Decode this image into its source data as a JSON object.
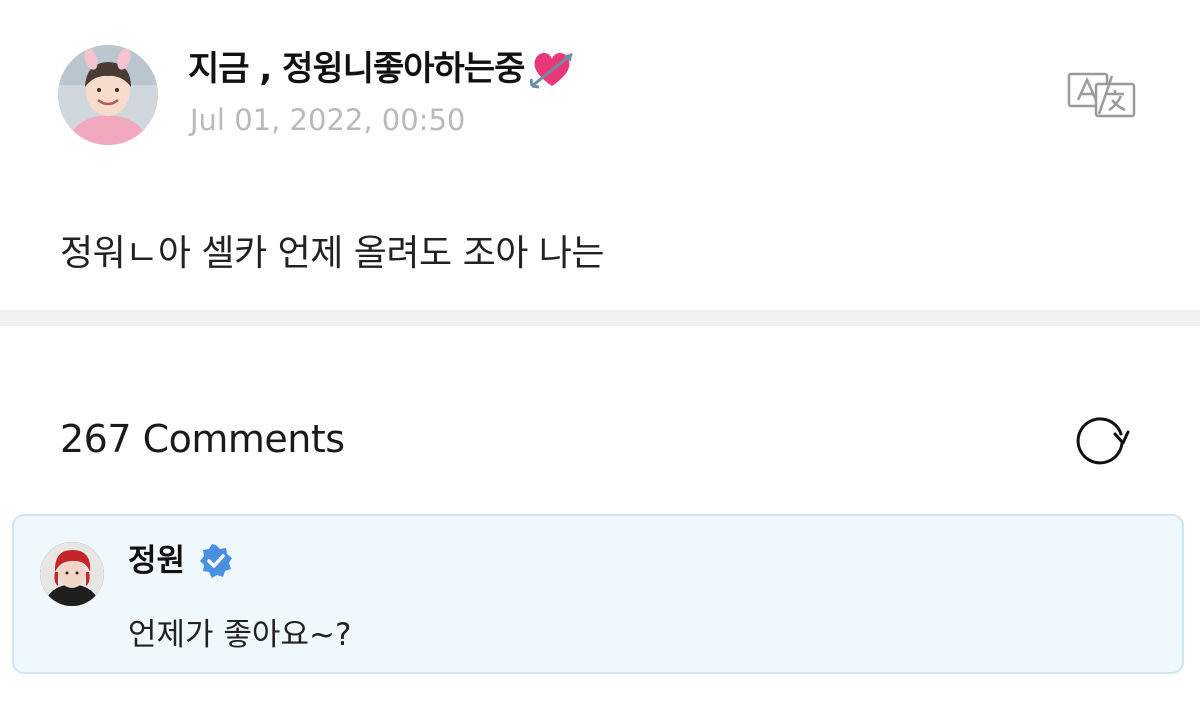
{
  "post": {
    "author_name": "지금 , 정윙니좋아하는중",
    "author_emoji_icon": "heart-with-arrow-icon",
    "timestamp": "Jul 01, 2022, 00:50",
    "body": "정워ㄴ아 셀카 언제 올려도 조아 나는",
    "translate_icon": "translate-icon"
  },
  "comments_section": {
    "count_label": "267 Comments",
    "refresh_icon": "refresh-icon"
  },
  "comments": [
    {
      "name": "정원",
      "verified": true,
      "text": "언제가 좋아요~?"
    }
  ],
  "colors": {
    "timestamp": "#b9b9b9",
    "divider": "#f1f1f3",
    "comment_bg": "#eef8fd",
    "comment_border": "#cfe6f2",
    "verified_badge": "#4a90e2",
    "heart": "#e8387a"
  }
}
